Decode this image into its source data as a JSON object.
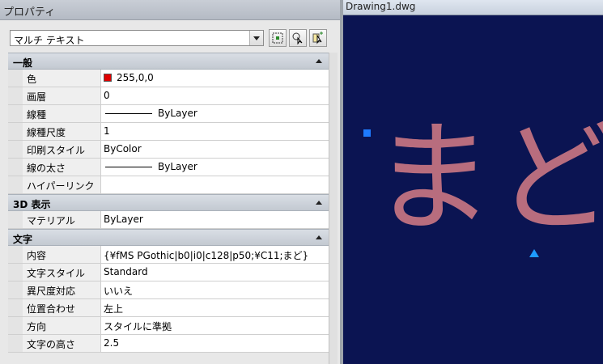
{
  "palette": {
    "title": "プロパティ",
    "object_type": "マルチ テキスト",
    "toolbar": [
      "select-objects-icon",
      "quick-select-icon",
      "toggle-pickadd-icon"
    ]
  },
  "sections": [
    {
      "title": "一般",
      "rows": [
        {
          "name": "色",
          "value": "255,0,0",
          "swatch": "#e00000"
        },
        {
          "name": "画層",
          "value": "0"
        },
        {
          "name": "線種",
          "value": "ByLayer",
          "line": true
        },
        {
          "name": "線種尺度",
          "value": "1"
        },
        {
          "name": "印刷スタイル",
          "value": "ByColor"
        },
        {
          "name": "線の太さ",
          "value": "ByLayer",
          "line": true
        },
        {
          "name": "ハイパーリンク",
          "value": ""
        }
      ]
    },
    {
      "title": "3D 表示",
      "rows": [
        {
          "name": "マテリアル",
          "value": "ByLayer"
        }
      ]
    },
    {
      "title": "文字",
      "rows": [
        {
          "name": "内容",
          "value": "{¥fMS PGothic|b0|i0|c128|p50;¥C11;まど}"
        },
        {
          "name": "文字スタイル",
          "value": "Standard"
        },
        {
          "name": "異尺度対応",
          "value": "いいえ"
        },
        {
          "name": "位置合わせ",
          "value": "左上"
        },
        {
          "name": "方向",
          "value": "スタイルに準拠"
        },
        {
          "name": "文字の高さ",
          "value": "2.5"
        }
      ]
    }
  ],
  "drawing": {
    "title": "Drawing1.dwg",
    "mtext": "まど",
    "background": "#0b1452",
    "text_color": "#b86d7e",
    "grip_color": "#1e7bff"
  }
}
